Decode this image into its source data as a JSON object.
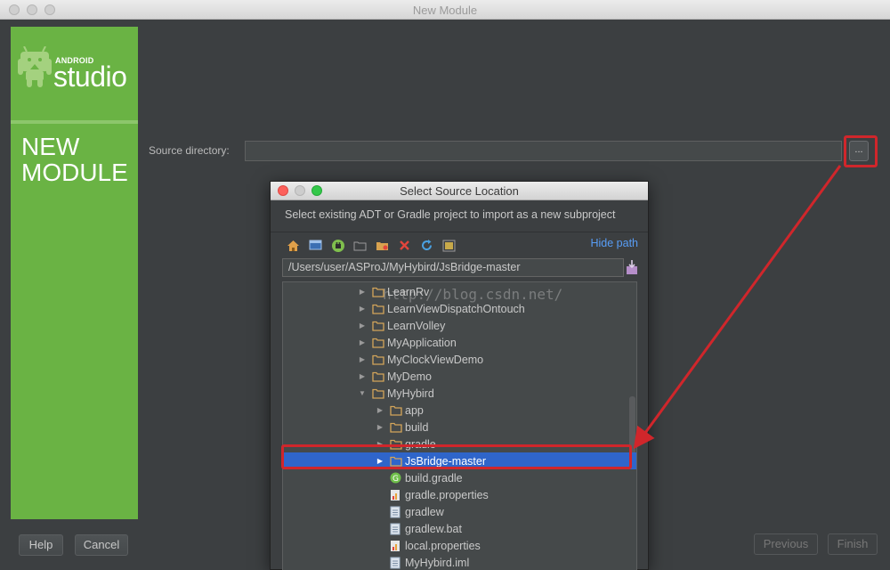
{
  "window": {
    "title": "New Module"
  },
  "sidebar": {
    "logo_small": "ANDROID",
    "logo_big": "studio",
    "heading_line1": "NEW",
    "heading_line2": "MODULE"
  },
  "form": {
    "source_label": "Source directory:",
    "source_value": "",
    "browse_label": "..."
  },
  "footer": {
    "help": "Help",
    "cancel": "Cancel",
    "previous": "Previous",
    "finish": "Finish"
  },
  "dialog": {
    "title": "Select Source Location",
    "description": "Select existing ADT or Gradle project to import as a new subproject",
    "hide_path": "Hide path",
    "path": "/Users/user/ASProJ/MyHybird/JsBridge-master",
    "toolbar_icons": [
      "home-icon",
      "desktop-icon",
      "android-project-icon",
      "new-folder-icon",
      "new-folder-sparkle-icon",
      "delete-icon",
      "refresh-icon",
      "show-hidden-icon"
    ],
    "tree": [
      {
        "label": "LearnRv",
        "type": "folder",
        "level": 0,
        "expanded": false
      },
      {
        "label": "LearnViewDispatchOntouch",
        "type": "folder",
        "level": 0,
        "expanded": false
      },
      {
        "label": "LearnVolley",
        "type": "folder",
        "level": 0,
        "expanded": false
      },
      {
        "label": "MyApplication",
        "type": "folder",
        "level": 0,
        "expanded": false
      },
      {
        "label": "MyClockViewDemo",
        "type": "folder",
        "level": 0,
        "expanded": false
      },
      {
        "label": "MyDemo",
        "type": "folder",
        "level": 0,
        "expanded": false
      },
      {
        "label": "MyHybird",
        "type": "folder",
        "level": 0,
        "expanded": true
      },
      {
        "label": "app",
        "type": "folder",
        "level": 1,
        "expanded": false
      },
      {
        "label": "build",
        "type": "folder",
        "level": 1,
        "expanded": false
      },
      {
        "label": "gradle",
        "type": "folder",
        "level": 1,
        "expanded": false
      },
      {
        "label": "JsBridge-master",
        "type": "folder",
        "level": 1,
        "expanded": false,
        "selected": true
      },
      {
        "label": "build.gradle",
        "type": "gradle",
        "level": 1
      },
      {
        "label": "gradle.properties",
        "type": "properties",
        "level": 1
      },
      {
        "label": "gradlew",
        "type": "file",
        "level": 1
      },
      {
        "label": "gradlew.bat",
        "type": "file",
        "level": 1
      },
      {
        "label": "local.properties",
        "type": "properties",
        "level": 1
      },
      {
        "label": "MyHybird.iml",
        "type": "file",
        "level": 1
      }
    ]
  },
  "watermark": "http://blog.csdn.net/",
  "colors": {
    "android_green": "#6ab344",
    "selection_blue": "#2f65ca",
    "annotation_red": "#d0262b",
    "link_blue": "#589df6"
  }
}
